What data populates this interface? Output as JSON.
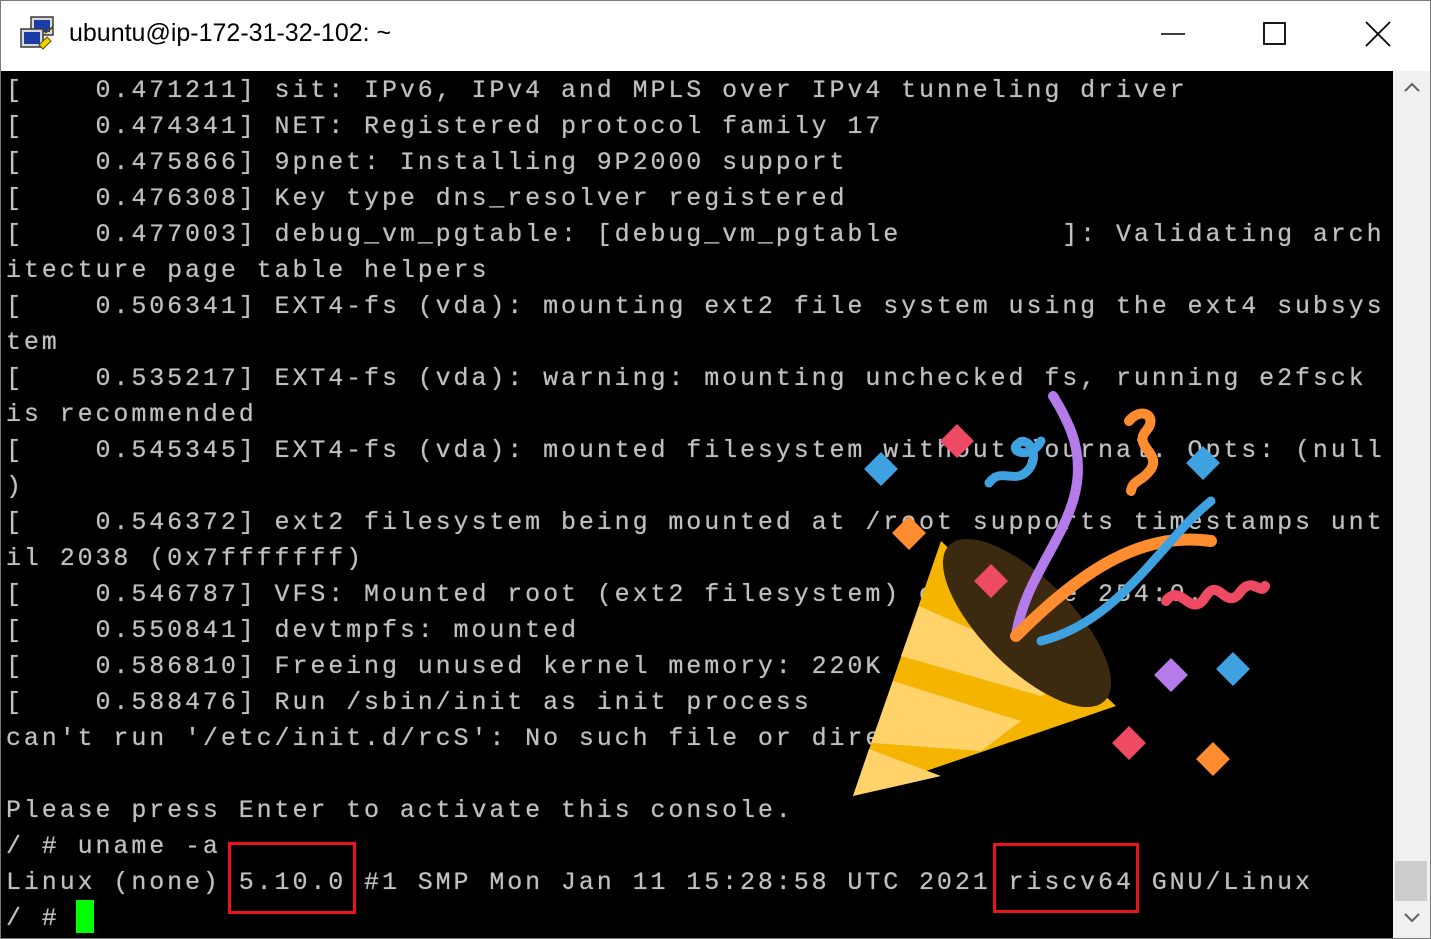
{
  "window": {
    "title": "ubuntu@ip-172-31-32-102: ~",
    "app_icon": "putty-icon",
    "controls": {
      "minimize": "minimize-icon",
      "maximize": "maximize-icon",
      "close": "close-icon"
    }
  },
  "terminal": {
    "lines": [
      "[    0.471211] sit: IPv6, IPv4 and MPLS over IPv4 tunneling driver",
      "[    0.474341] NET: Registered protocol family 17",
      "[    0.475866] 9pnet: Installing 9P2000 support",
      "[    0.476308] Key type dns_resolver registered",
      "[    0.477003] debug_vm_pgtable: [debug_vm_pgtable         ]: Validating arch",
      "itecture page table helpers",
      "[    0.506341] EXT4-fs (vda): mounting ext2 file system using the ext4 subsys",
      "tem",
      "[    0.535217] EXT4-fs (vda): warning: mounting unchecked fs, running e2fsck",
      "is recommended",
      "[    0.545345] EXT4-fs (vda): mounted filesystem without journal. Opts: (null",
      ")",
      "[    0.546372] ext2 filesystem being mounted at /root supports timestamps unt",
      "il 2038 (0x7fffffff)",
      "[    0.546787] VFS: Mounted root (ext2 filesystem) on device 254:0.",
      "[    0.550841] devtmpfs: mounted",
      "[    0.586810] Freeing unused kernel memory: 220K",
      "[    0.588476] Run /sbin/init as init process",
      "can't run '/etc/init.d/rcS': No such file or directory",
      "",
      "Please press Enter to activate this console.",
      "/ # uname -a",
      "Linux (none) 5.10.0 #1 SMP Mon Jan 11 15:28:58 UTC 2021 riscv64 GNU/Linux",
      "/ # "
    ],
    "highlights": [
      "5.10.0",
      "riscv64"
    ],
    "cursor_color": "#00ff00",
    "text_color": "#c0c0c0",
    "highlight_color": "#e8141c"
  },
  "overlay": {
    "emoji": "party-popper-icon"
  },
  "scrollbar": {
    "up": "chevron-up-icon",
    "down": "chevron-down-icon"
  }
}
